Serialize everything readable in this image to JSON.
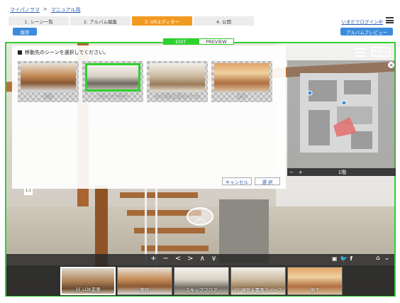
{
  "breadcrumb": {
    "home": "マイパノラマ",
    "sep": ">",
    "current": "マニュアル用"
  },
  "steps": [
    {
      "label": "1. シーン一覧",
      "active": false
    },
    {
      "label": "2. アルバム編集",
      "active": false
    },
    {
      "label": "3. VRエディター",
      "active": true
    },
    {
      "label": "4. 公開",
      "active": false
    }
  ],
  "header": {
    "login_label": "いまだでログイン中",
    "save_label": "保存",
    "album_preview_label": "アルバムプレビュー"
  },
  "mode_toggle": {
    "edit": "EDIT",
    "preview": "PREVIEW",
    "selected": "EDIT"
  },
  "dialog": {
    "title": "移動先のシーンを選択してください。",
    "scenes": [
      {
        "label": "階段",
        "selected": false
      },
      {
        "label": "スキップフロア",
        "selected": true
      },
      {
        "label": "2F 寝室＆書斎スペース",
        "selected": false
      },
      {
        "label": "地下",
        "selected": false
      }
    ],
    "cancel_label": "キャンセル",
    "choose_label": "選 択"
  },
  "viewer": {
    "full_label": "FULL",
    "map_close": "×",
    "map_zoom_out": "−",
    "map_zoom_in": "+",
    "floor_label": "1階",
    "tiny_label": "1:1"
  },
  "nav_controls": [
    "+",
    "−",
    "<",
    ">",
    "∧",
    "∨"
  ],
  "share_icons": [
    "fullscreen-icon",
    "twitter-icon",
    "facebook-icon"
  ],
  "filmstrip": [
    {
      "label": "1F LDK変更",
      "current": true
    },
    {
      "label": "階段",
      "current": false
    },
    {
      "label": "スキップフロア",
      "current": false
    },
    {
      "label": "2F 寝室＆書斎スペース",
      "current": false
    },
    {
      "label": "地下",
      "current": false
    }
  ],
  "colors": {
    "accent_green": "#2fd12f",
    "active_step": "#f29a1f",
    "button_blue": "#3c8cdc"
  }
}
